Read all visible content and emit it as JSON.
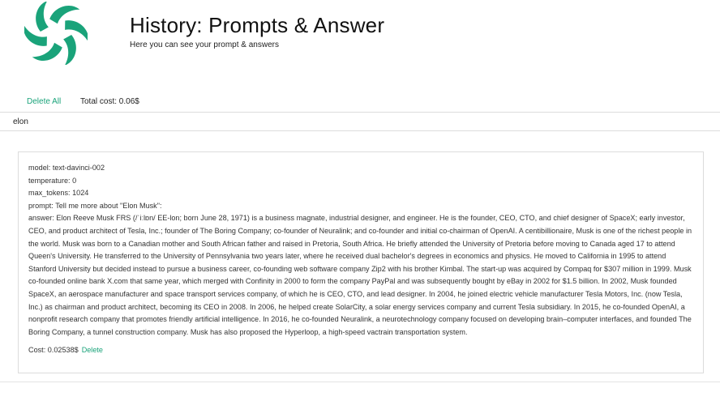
{
  "header": {
    "title": "History: Prompts & Answer",
    "subtitle": "Here you can see your prompt & answers",
    "logo_color": "#1aa37a"
  },
  "toolbar": {
    "delete_all_label": "Delete All",
    "total_cost": "Total cost: 0.06$"
  },
  "search": {
    "value": "elon"
  },
  "entries": [
    {
      "model": "model: text-davinci-002",
      "temperature": "temperature: 0",
      "max_tokens": "max_tokens: 1024",
      "prompt": "prompt: Tell me more about \"Elon Musk\":",
      "answer": "answer: Elon Reeve Musk FRS (/ˈiːlɒn/ EE-lon; born June 28, 1971) is a business magnate, industrial designer, and engineer. He is the founder, CEO, CTO, and chief designer of SpaceX; early investor, CEO, and product architect of Tesla, Inc.; founder of The Boring Company; co-founder of Neuralink; and co-founder and initial co-chairman of OpenAI. A centibillionaire, Musk is one of the richest people in the world. Musk was born to a Canadian mother and South African father and raised in Pretoria, South Africa. He briefly attended the University of Pretoria before moving to Canada aged 17 to attend Queen's University. He transferred to the University of Pennsylvania two years later, where he received dual bachelor's degrees in economics and physics. He moved to California in 1995 to attend Stanford University but decided instead to pursue a business career, co-founding web software company Zip2 with his brother Kimbal. The start-up was acquired by Compaq for $307 million in 1999. Musk co-founded online bank X.com that same year, which merged with Confinity in 2000 to form the company PayPal and was subsequently bought by eBay in 2002 for $1.5 billion. In 2002, Musk founded SpaceX, an aerospace manufacturer and space transport services company, of which he is CEO, CTO, and lead designer. In 2004, he joined electric vehicle manufacturer Tesla Motors, Inc. (now Tesla, Inc.) as chairman and product architect, becoming its CEO in 2008. In 2006, he helped create SolarCity, a solar energy services company and current Tesla subsidiary. In 2015, he co-founded OpenAI, a nonprofit research company that promotes friendly artificial intelligence. In 2016, he co-founded Neuralink, a neurotechnology company focused on developing brain–computer interfaces, and founded The Boring Company, a tunnel construction company. Musk has also proposed the Hyperloop, a high-speed vactrain transportation system.",
      "cost": "Cost: 0.02538$",
      "delete_label": "Delete"
    }
  ]
}
